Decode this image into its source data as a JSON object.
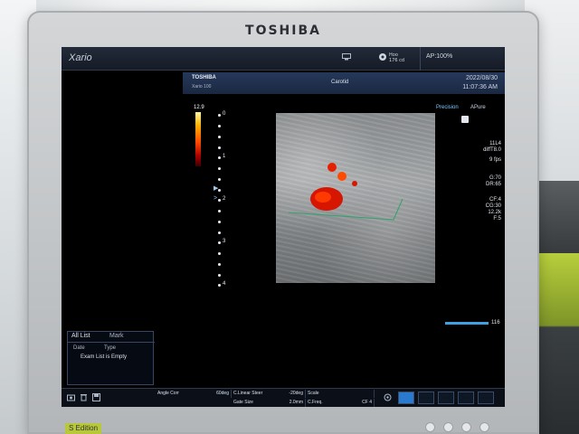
{
  "bezel": {
    "brand": "TOSHIBA",
    "edition": "S Edition"
  },
  "topbar": {
    "app_name": "Xario",
    "probe_val_1": "Hoo",
    "probe_val_2": "176 cd",
    "ap": "AP:100%"
  },
  "infobar": {
    "brand": "TOSHIBA",
    "model": "Xario 100",
    "preset": "Carotid",
    "date": "2022/08/30",
    "time": "11:07:36 AM"
  },
  "color_scale": {
    "max_label": "12.9"
  },
  "depth_scale": {
    "labels": [
      "0",
      "1",
      "2",
      "3",
      "4"
    ]
  },
  "right_panel": {
    "precision": "Precision",
    "apure": "APure",
    "params_block1": [
      "11L4",
      "diffT8.0",
      "9 fps"
    ],
    "params_block2": [
      "G:70",
      "DR:65"
    ],
    "params_block3": [
      "CF:4",
      "CG:30",
      "12.2k",
      "F:5"
    ]
  },
  "gain": {
    "value": "116"
  },
  "exam_panel": {
    "tab_all": "All List",
    "tab_mark": "Mark",
    "col_date": "Date",
    "col_type": "Type",
    "empty": "Exam List is Empty"
  },
  "bottom_bar": {
    "angle_corr": "Angle Corr",
    "angle_corr_val": "60deg",
    "clinear_steer": "C.Linear Steer",
    "clinear_steer_val": "-20deg",
    "scale": "Scale",
    "gate_size": "Gate Size",
    "gate_size_val": "2.0mm",
    "cfreq": "C.Freq.",
    "cfreq_val": "CF 4"
  },
  "colors": {
    "accent": "#2a7bd0",
    "infobar": "#1a2842",
    "doppler_red": "#e01a00"
  }
}
